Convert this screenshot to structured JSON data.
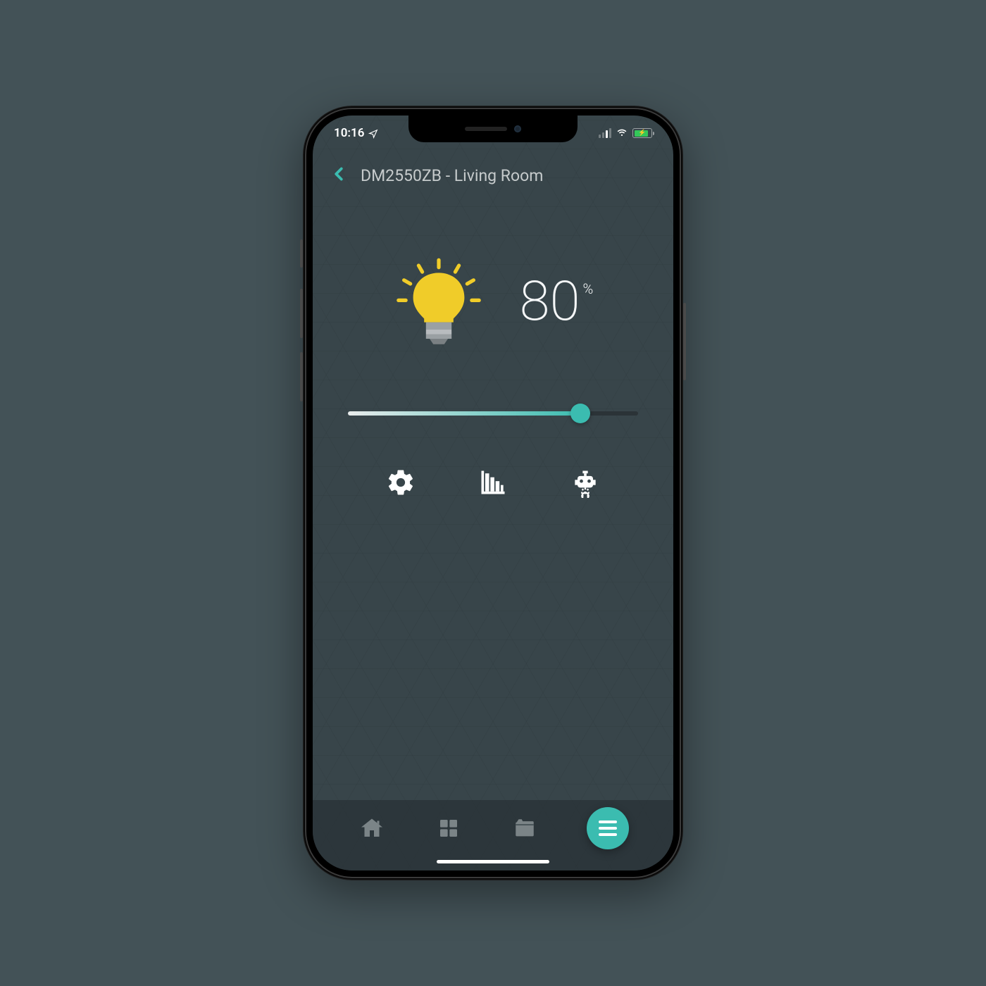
{
  "status_bar": {
    "time": "10:16"
  },
  "header": {
    "title": "DM2550ZB - Living Room"
  },
  "brightness": {
    "value": "80",
    "unit": "%",
    "slider_percent": 80
  },
  "colors": {
    "accent": "#3bbcb0",
    "bulb": "#f0cc29"
  }
}
